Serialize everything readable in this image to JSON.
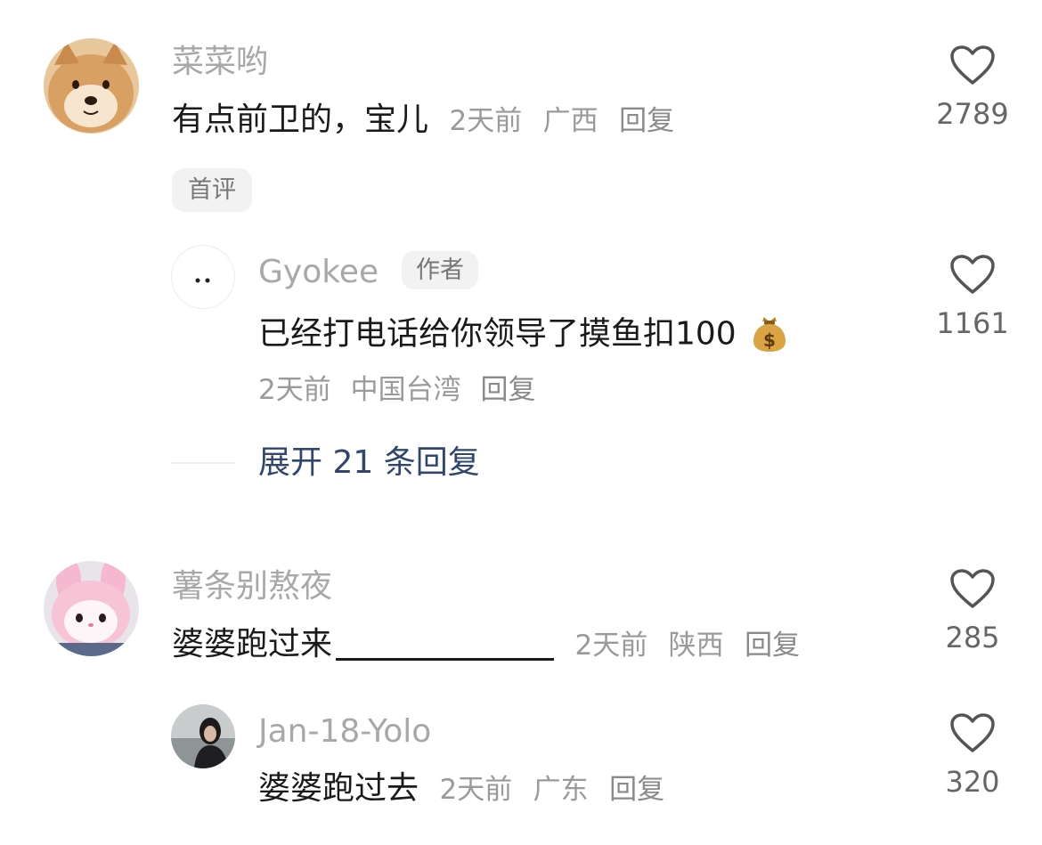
{
  "comments": [
    {
      "username": "菜菜哟",
      "text": "有点前卫的，宝儿",
      "time": "2天前",
      "location": "广西",
      "reply_label": "回复",
      "likes": "2789",
      "tag": "首评",
      "avatar_icon": "shiba-dog-avatar",
      "replies": [
        {
          "username": "Gyokee",
          "badge": "作者",
          "text": "已经打电话给你领导了摸鱼扣100",
          "emoji": "money-bag-icon",
          "time": "2天前",
          "location": "中国台湾",
          "reply_label": "回复",
          "likes": "1161",
          "avatar_icon": "dots-face-avatar"
        }
      ],
      "expand_label": "展开 21 条回复"
    },
    {
      "username": "薯条别熬夜",
      "text": "婆婆跑过来",
      "time": "2天前",
      "location": "陕西",
      "reply_label": "回复",
      "likes": "285",
      "avatar_icon": "pink-bunny-avatar",
      "replies": [
        {
          "username": "Jan-18-Yolo",
          "text": "婆婆跑过去",
          "time": "2天前",
          "location": "广东",
          "reply_label": "回复",
          "likes": "320",
          "avatar_icon": "girl-seaside-avatar"
        }
      ]
    }
  ],
  "colors": {
    "username": "#a8a8a8",
    "content": "#1a1a1a",
    "meta": "#9a9a9a",
    "expand": "#31466e",
    "tag_bg": "#f2f2f2"
  }
}
